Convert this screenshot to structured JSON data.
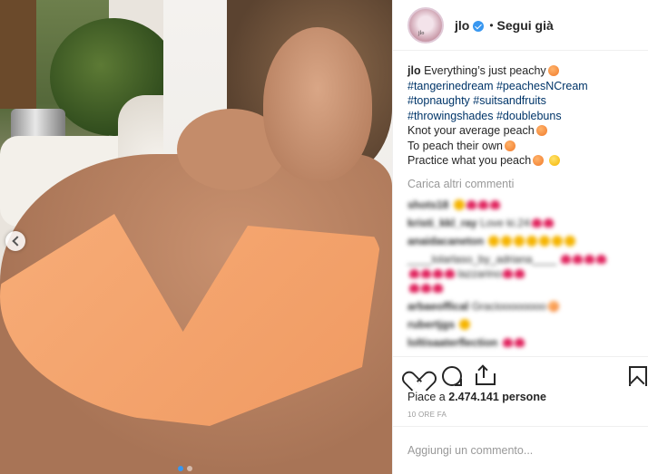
{
  "post": {
    "username": "jlo",
    "separator": "•",
    "follow_label": "Segui già"
  },
  "caption": {
    "username": "jlo",
    "line1": "Everything’s just peachy",
    "line2": "#tangerinedream #peachesNCream",
    "line3": "#topnaughty #suitsandfruits",
    "line4": "#throwingshades #doublebuns",
    "line5": "Knot your average peach",
    "line6": "To peach their own",
    "line7": "Practice what you peach"
  },
  "comments": {
    "load_more": "Carica altri commenti",
    "items": [
      {
        "user": "shots18",
        "text": ""
      },
      {
        "user": "kristi_kkl_ray",
        "text": "Love ki.24"
      },
      {
        "user": "anaidacaneton",
        "text": ""
      },
      {
        "user": "",
        "text": "____lolarlaso_by_adriana____"
      },
      {
        "user": "",
        "text": "lazzarino"
      },
      {
        "user": "arbaeoffical",
        "text": "Gracioooooooo"
      },
      {
        "user": "rubertjgs",
        "text": ""
      },
      {
        "user": "loltisaaterflection",
        "text": ""
      }
    ]
  },
  "stats": {
    "likes_prefix": "Piace a",
    "likes_count": "2.474.141",
    "likes_suffix": "persone",
    "time": "10 ORE FA"
  },
  "composer": {
    "placeholder": "Aggiungi un commento..."
  },
  "icons": {
    "verified": "verified-badge-icon",
    "like": "heart-icon",
    "comment": "comment-bubble-icon",
    "share": "share-icon",
    "save": "bookmark-icon",
    "carousel": "chevron-left-icon"
  },
  "colors": {
    "accent": "#3897f0",
    "hashtag": "#003569",
    "muted": "#999999",
    "text": "#262626"
  }
}
